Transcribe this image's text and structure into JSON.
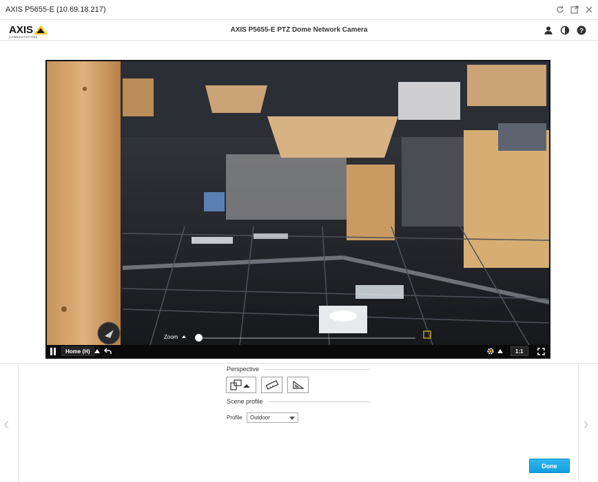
{
  "window": {
    "title": "AXIS P5655-E (10.69.18.217)"
  },
  "header": {
    "page_title": "AXIS P5655-E PTZ Dome Network Camera",
    "logo_text": "AXIS",
    "logo_subtext": "COMMUNICATIONS"
  },
  "viewer": {
    "zoom_label": "Zoom",
    "preset_label": "Home (H)",
    "ratio_label": "1:1"
  },
  "perspective": {
    "title": "Perspective"
  },
  "scene_profile": {
    "title": "Scene profile",
    "profile_label": "Profile",
    "profile_value": "Outdoor"
  },
  "actions": {
    "done_label": "Done"
  },
  "colors": {
    "accent": "#1aa5e6",
    "logo_yellow": "#f4c600"
  }
}
